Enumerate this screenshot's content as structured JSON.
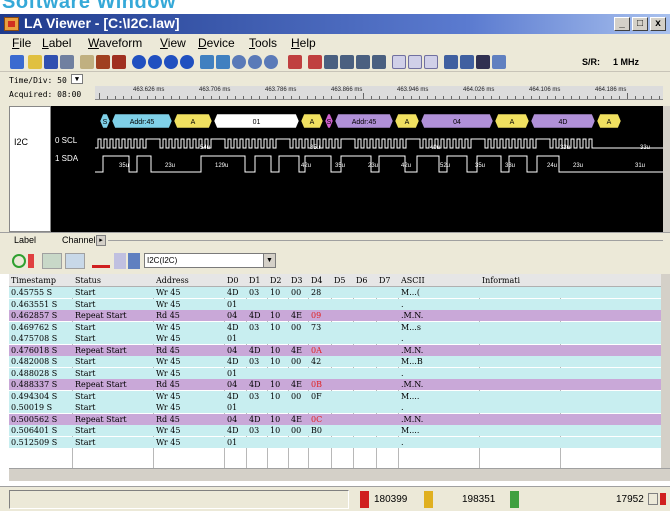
{
  "banner": {
    "text": "Software Window"
  },
  "window": {
    "title": "LA Viewer - [C:\\I2C.law]",
    "buttons": {
      "minimize": "_",
      "restore": "□",
      "close": "x"
    }
  },
  "menu": [
    "File",
    "Label",
    "Waveform",
    "View",
    "Device",
    "Tools",
    "Help"
  ],
  "toolbar": {
    "sample_rate_label": "S/R:",
    "sample_rate_value": "1 MHz"
  },
  "wave_header": {
    "time_div": "Time/Div: 50 u",
    "acquired": "Acquired: 08:00",
    "ruler_ticks": [
      "463.626 ms",
      "463.706 ms",
      "463.786 ms",
      "463.866 ms",
      "463.946 ms",
      "464.026 ms",
      "464.106 ms",
      "464.186 ms"
    ]
  },
  "channels": {
    "bus_label": "I2C",
    "scl_label": "0 SCL",
    "sda_label": "1 SDA"
  },
  "bus_segments": [
    {
      "text": "S",
      "color": "#7fd0e8"
    },
    {
      "text": "Addr:45",
      "color": "#7fd0e8"
    },
    {
      "text": "A",
      "color": "#f0e060"
    },
    {
      "text": "01",
      "color": "#ffffff"
    },
    {
      "text": "A",
      "color": "#f0e060"
    },
    {
      "text": "S",
      "color": "#d060d0"
    },
    {
      "text": "Addr:45",
      "color": "#b090d8"
    },
    {
      "text": "A",
      "color": "#f0e060"
    },
    {
      "text": "04",
      "color": "#b090d8"
    },
    {
      "text": "A",
      "color": "#f0e060"
    },
    {
      "text": "4D",
      "color": "#b090d8"
    },
    {
      "text": "A",
      "color": "#f0e060"
    }
  ],
  "scl_durations": [
    "54u",
    "35u",
    "40u",
    "33u",
    "33u"
  ],
  "sda_durations": [
    "35u",
    "23u",
    "129u",
    "42u",
    "35u",
    "23u",
    "42u",
    "52u",
    "35u",
    "33u",
    "24u",
    "23u",
    "31u"
  ],
  "tabs": {
    "label": "Label",
    "channel": "Channel"
  },
  "bus_toolbar": {
    "select_value": "I2C(I2C)"
  },
  "table": {
    "headers": [
      "Timestamp",
      "Status",
      "Address",
      "D0",
      "D1",
      "D2",
      "D3",
      "D4",
      "D5",
      "D6",
      "D7",
      "ASCII",
      "Informati"
    ],
    "rows": [
      {
        "kind": "start",
        "cells": [
          "0.45755 S",
          "Start",
          "Wr 45",
          "4D",
          "03",
          "10",
          "00",
          "28",
          "",
          "",
          "",
          "M...(",
          ""
        ]
      },
      {
        "kind": "start",
        "cells": [
          "0.463551 S",
          "Start",
          "Wr 45",
          "01",
          "",
          "",
          "",
          "",
          "",
          "",
          "",
          ".",
          ""
        ]
      },
      {
        "kind": "repeat",
        "cells": [
          "0.462857 S",
          "Repeat Start",
          "Rd 45",
          "04",
          "4D",
          "10",
          "4E",
          "09",
          "",
          "",
          "",
          ".M.N.",
          ""
        ],
        "red": [
          7
        ]
      },
      {
        "kind": "start",
        "cells": [
          "0.469762 S",
          "Start",
          "Wr 45",
          "4D",
          "03",
          "10",
          "00",
          "73",
          "",
          "",
          "",
          "M...s",
          ""
        ]
      },
      {
        "kind": "start",
        "cells": [
          "0.475708 S",
          "Start",
          "Wr 45",
          "01",
          "",
          "",
          "",
          "",
          "",
          "",
          "",
          ".",
          ""
        ]
      },
      {
        "kind": "repeat",
        "cells": [
          "0.476018 S",
          "Repeat Start",
          "Rd 45",
          "04",
          "4D",
          "10",
          "4E",
          "0A",
          "",
          "",
          "",
          ".M.N.",
          ""
        ],
        "red": [
          7
        ]
      },
      {
        "kind": "start",
        "cells": [
          "0.482008 S",
          "Start",
          "Wr 45",
          "4D",
          "03",
          "10",
          "00",
          "42",
          "",
          "",
          "",
          "M...B",
          ""
        ]
      },
      {
        "kind": "start",
        "cells": [
          "0.488028 S",
          "Start",
          "Wr 45",
          "01",
          "",
          "",
          "",
          "",
          "",
          "",
          "",
          ".",
          ""
        ]
      },
      {
        "kind": "repeat",
        "cells": [
          "0.488337 S",
          "Repeat Start",
          "Rd 45",
          "04",
          "4D",
          "10",
          "4E",
          "0B",
          "",
          "",
          "",
          ".M.N.",
          ""
        ],
        "red": [
          7
        ]
      },
      {
        "kind": "start",
        "cells": [
          "0.494304 S",
          "Start",
          "Wr 45",
          "4D",
          "03",
          "10",
          "00",
          "0F",
          "",
          "",
          "",
          "M....",
          ""
        ]
      },
      {
        "kind": "start",
        "cells": [
          "0.50019 S",
          "Start",
          "Wr 45",
          "01",
          "",
          "",
          "",
          "",
          "",
          "",
          "",
          ".",
          ""
        ]
      },
      {
        "kind": "repeat",
        "cells": [
          "0.500562 S",
          "Repeat Start",
          "Rd 45",
          "04",
          "4D",
          "10",
          "4E",
          "0C",
          "",
          "",
          "",
          ".M.N.",
          ""
        ],
        "red": [
          7
        ]
      },
      {
        "kind": "start",
        "cells": [
          "0.506401 S",
          "Start",
          "Wr 45",
          "4D",
          "03",
          "10",
          "00",
          "B0",
          "",
          "",
          "",
          "M....",
          ""
        ]
      },
      {
        "kind": "start",
        "cells": [
          "0.512509 S",
          "Start",
          "Wr 45",
          "01",
          "",
          "",
          "",
          "",
          "",
          "",
          "",
          ".",
          ""
        ]
      }
    ]
  },
  "status": {
    "cursor_a_b": "180399",
    "cursor_b_c": "198351",
    "cursor_c": "17952"
  }
}
